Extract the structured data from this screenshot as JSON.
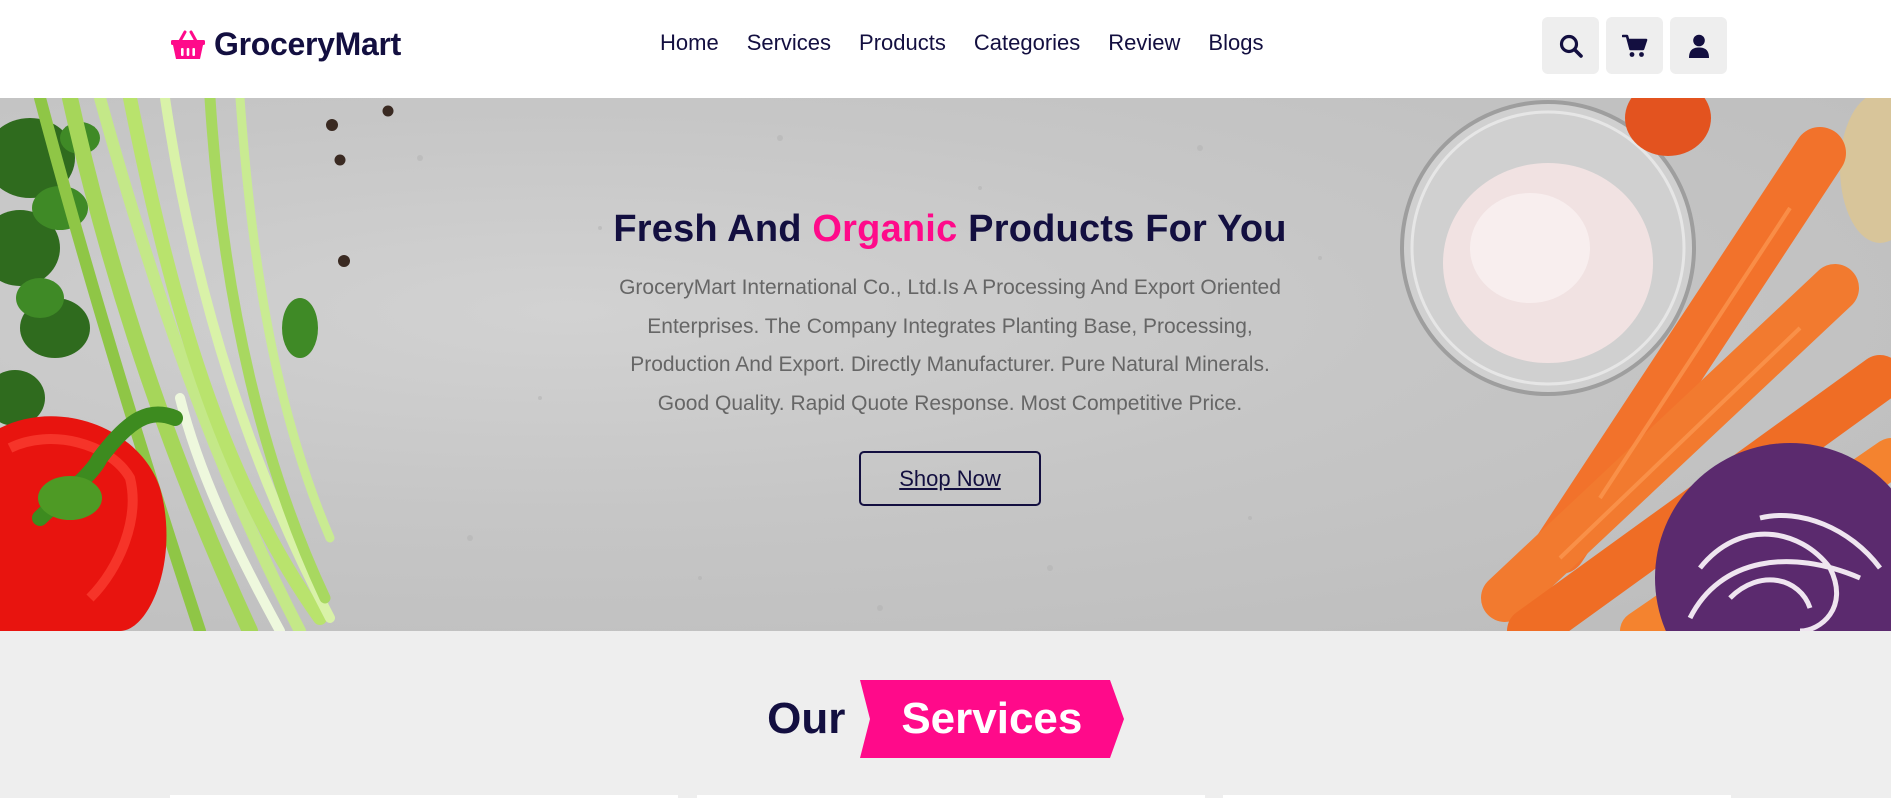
{
  "brand": {
    "name": "GroceryMart",
    "icon": "basket-icon",
    "accent": "#ff0a8a",
    "dark": "#130f40"
  },
  "nav": [
    {
      "label": "Home"
    },
    {
      "label": "Services"
    },
    {
      "label": "Products"
    },
    {
      "label": "Categories"
    },
    {
      "label": "Review"
    },
    {
      "label": "Blogs"
    }
  ],
  "header_icons": [
    "search-icon",
    "cart-icon",
    "user-icon"
  ],
  "hero": {
    "title_before": "Fresh And",
    "title_accent": "Organic",
    "title_after": "Products For You",
    "lines": [
      "GroceryMart International Co., Ltd.Is A Processing And Export Oriented",
      "Enterprises. The Company Integrates Planting Base, Processing,",
      "Production And Export. Directly Manufacturer. Pure Natural Minerals.",
      "Good Quality. Rapid Quote Response. Most Competitive Price."
    ],
    "button_label": "Shop Now"
  },
  "services": {
    "heading_plain": "Our",
    "heading_ribbon": "Services"
  }
}
